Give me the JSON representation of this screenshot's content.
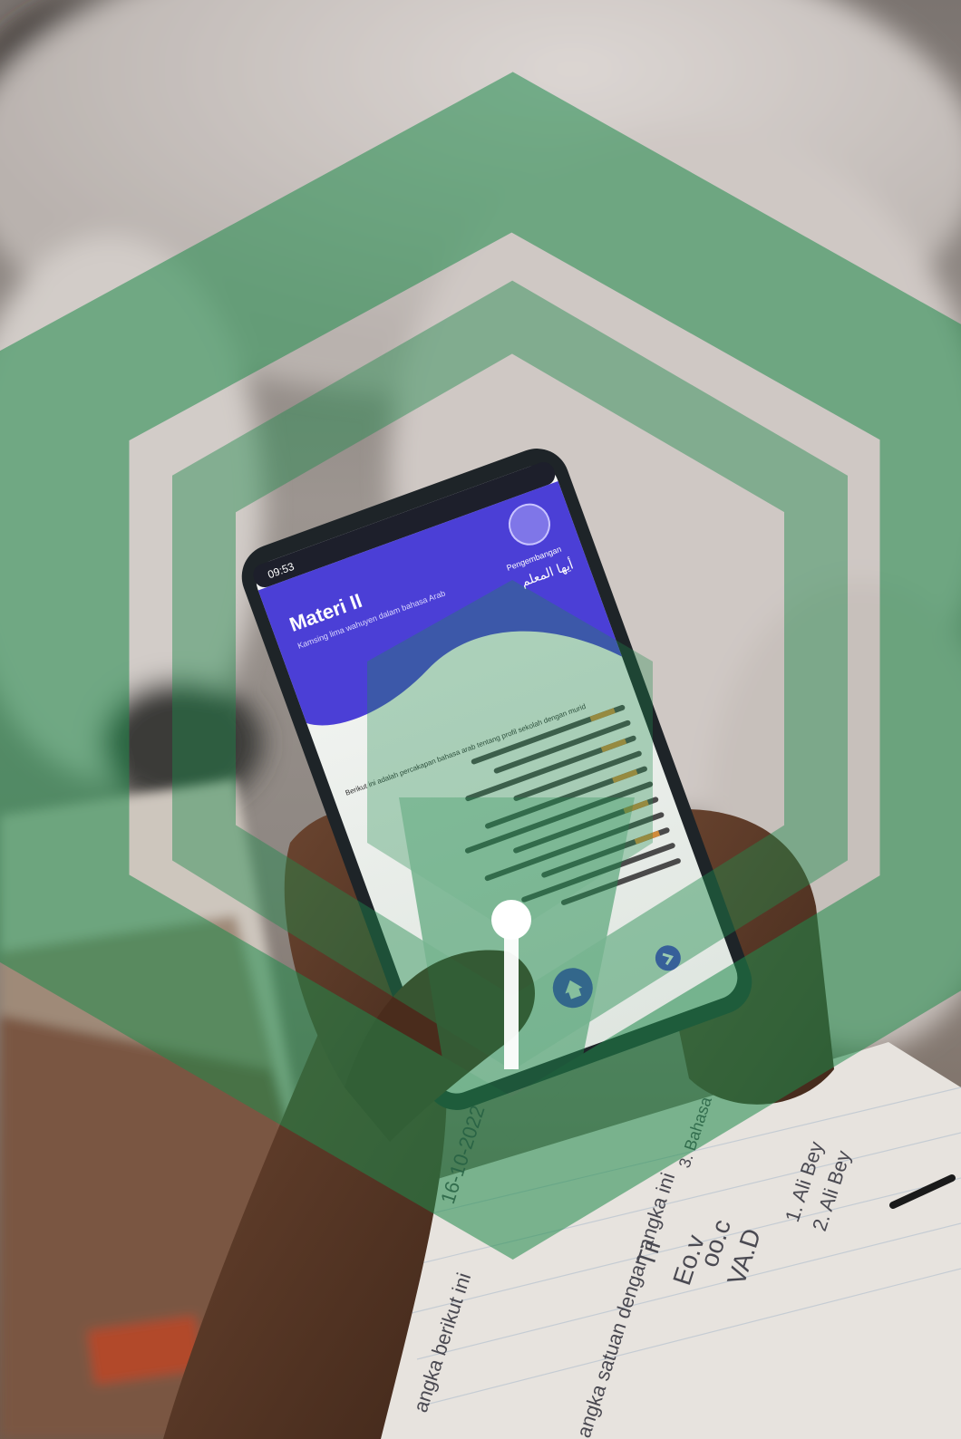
{
  "photo": {
    "subject": "student-holding-smartphone",
    "colors": {
      "background_top": "#a9a39f",
      "background_cloth": "#d8d3d0",
      "desk": "#8a6a52",
      "notebook": "#e9e6e1",
      "skin": "#5c3a26",
      "phone_body": "#1e2428",
      "screen": "#f2f4f1",
      "app_header": "#4b3fd6",
      "watermark": "#1f8a4c"
    }
  },
  "phone_screen": {
    "status_time": "09:53",
    "header": {
      "title": "Materi II",
      "subtitle": "Kamsing lima wahuyen dalam bahasa Arab"
    },
    "header_right_text": "Pengembangan",
    "arabic_logo_text": "أيها المعلم",
    "intro_text": "Berikut ini adalah percakapan bahasa arab tentang profil sekolah dengan murid"
  },
  "notebook": {
    "lines": [
      "16-10-2022",
      "angka berikut ini",
      "angka satuan dengan angka ini",
      "Tii",
      "Eo.v",
      "oo.c",
      "VA.D",
      "1. Ali Bey",
      "2. Ali Bey",
      "3. Bahasa arab"
    ]
  },
  "watermark": {
    "icon": "pen-nib-hexagon-logo"
  }
}
